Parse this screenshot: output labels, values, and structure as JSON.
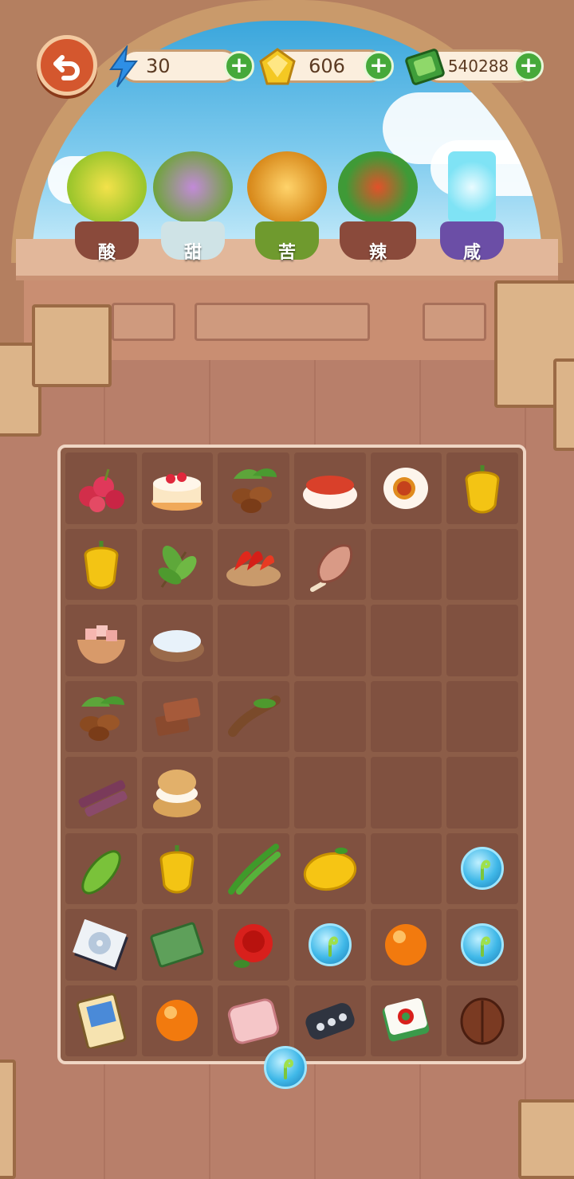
{
  "hud": {
    "energy": "30",
    "gems": "606",
    "cash": "540288",
    "plus": "+"
  },
  "plants": [
    {
      "label": "酸",
      "flavor": "sour",
      "color": "#d5c21f"
    },
    {
      "label": "甜",
      "flavor": "sweet",
      "color": "#8d5aa8"
    },
    {
      "label": "苦",
      "flavor": "bitter",
      "color": "#e39a2a"
    },
    {
      "label": "辣",
      "flavor": "spicy",
      "color": "#3f9a37"
    },
    {
      "label": "咸",
      "flavor": "salty",
      "color": "#7fe3f5"
    }
  ],
  "board": {
    "columns": 6,
    "rows": 8,
    "cells": [
      [
        "lychee",
        "strawberry-cake",
        "coffee-beans",
        "chili-powder",
        "salted-egg",
        "yellow-pepper"
      ],
      [
        "yellow-pepper",
        "tea-leaves",
        "red-chilies",
        "ham-leg",
        "",
        ""
      ],
      [
        "pink-salt-bowl",
        "sea-salt-bowl",
        "",
        "",
        "",
        ""
      ],
      [
        "coffee-beans",
        "brown-sugar",
        "tamarind",
        "",
        "",
        ""
      ],
      [
        "sugarcane",
        "cream-puff",
        "",
        "",
        "",
        ""
      ],
      [
        "bitter-melon",
        "yellow-pepper",
        "green-chilies",
        "lemon",
        "",
        "sprout-bubble"
      ],
      [
        "cd-disc",
        "green-notebook",
        "red-rose",
        "sprout-bubble",
        "orange-orb",
        "sprout-bubble"
      ],
      [
        "trading-card",
        "orange-orb",
        "pink-cushion",
        "car-key",
        "mahjong-tile",
        "walnut"
      ]
    ]
  },
  "floating": "sprout-bubble",
  "colors": {
    "sky": "#3aa6dc",
    "board": "#8c5d48",
    "plus_button": "#46a93a",
    "back_button": "#d4572e"
  }
}
